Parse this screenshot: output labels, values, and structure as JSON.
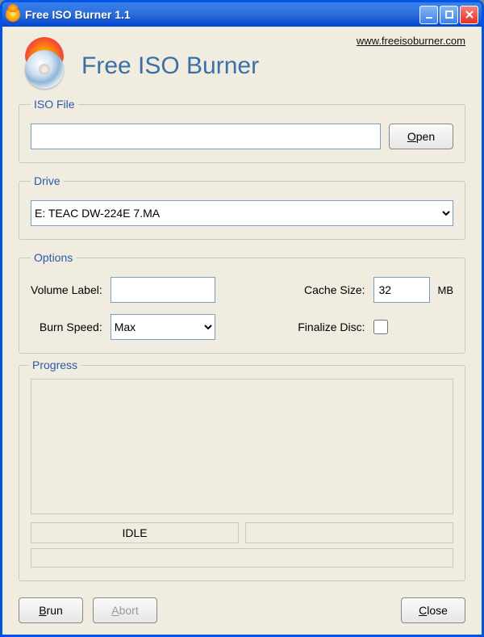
{
  "window": {
    "title": "Free ISO Burner 1.1"
  },
  "branding": {
    "title": "Free ISO Burner",
    "website_label": "www.freeisoburner.com"
  },
  "iso": {
    "legend": "ISO File",
    "path_value": "",
    "open_label": "Open"
  },
  "drive": {
    "legend": "Drive",
    "selected": "E: TEAC    DW-224E        7.MA"
  },
  "options": {
    "legend": "Options",
    "volume_label_text": "Volume Label:",
    "volume_label_value": "",
    "cache_size_text": "Cache Size:",
    "cache_size_value": "32",
    "cache_size_unit": "MB",
    "burn_speed_text": "Burn Speed:",
    "burn_speed_value": "Max",
    "finalize_disc_text": "Finalize Disc:",
    "finalize_disc_checked": false
  },
  "progress": {
    "legend": "Progress",
    "status_text": "IDLE",
    "secondary_text": ""
  },
  "footer": {
    "burn_label": "Brun",
    "abort_label": "Abort",
    "close_label": "Close"
  }
}
